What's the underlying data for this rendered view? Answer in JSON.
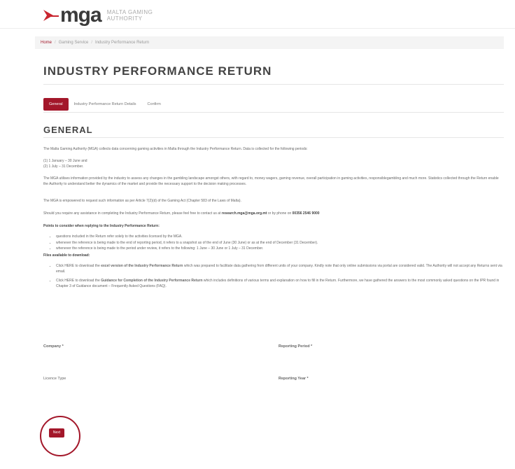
{
  "brand": {
    "logo_text": "mga",
    "logo_sub_line1": "MALTA GAMING",
    "logo_sub_line2": "AUTHORITY"
  },
  "breadcrumb": {
    "home": "Home",
    "items": [
      "Gaming Service",
      "Industry Performance Return"
    ]
  },
  "page_title": "INDUSTRY PERFORMANCE RETURN",
  "tabs": [
    {
      "label": "General",
      "active": true
    },
    {
      "label": "Industry Performance Return Details",
      "active": false
    },
    {
      "label": "Confirm",
      "active": false
    }
  ],
  "section_title": "GENERAL",
  "content": {
    "intro": "The Malta Gaming Authority (MGA) collects data concerning gaming activities in Malta through the Industry Performance Return. Data is collected for the following periods:",
    "period1": "(1) 1 January – 30 June and",
    "period2": "(2) 1 July – 31 December.",
    "utilises": "The MGA utilises information provided by the industry to assess any changes in the gambling landscape amongst others, with regard to, money wagers, gaming revenue, overall participation in gaming activities, responsiblegambling and much more. Statistics collected through the Return enable the Authority to understand better the dynamics of the market and provide the necessary support to the decision making processes.",
    "empowered": "The MGA is empowered to request such information as per Article 7(2)(d) of the Gaming Act (Chapter 583 of the Laws of Malta).",
    "assistance_pre": "Should you require any assistance in completing the Industry Performance Return, please feel free to contact us at",
    "assistance_email": "research.mga@mga.org.mt",
    "assistance_mid": "or by phone on",
    "assistance_phone": "00356 2546 9000",
    "points_heading": "Points to consider when replying to the Industry Performance Return:",
    "points": [
      "questions included in the Return refer solely to the activities licensed by the MGA.",
      "whenever the reference is being made to the end of reporting period, it refers to a snapshot as of the end of June (30 June) or as at the end of December (31 December).",
      "whenever the reference is being made to the period under review, it refers to the following: 1 June – 30 June or 1 July – 31 December."
    ],
    "files_heading": "Files available to download:",
    "file1_pre": "Click HERE to download the",
    "file1_bold": "excel version of the Industry Performance Return",
    "file1_post": "which was prepared to facilitate data gathering from different units of your company. Kindly note that only online submissions via portal are considered valid. The Authority will not accept any Returns sent via email.",
    "file2_pre": "Click HERE to download the",
    "file2_bold": "Guidance for Completion of the Industry Performance Return",
    "file2_post": "which includes definitions of various terms and explanation on how to fill in the Return. Furthermore, we have gathered the answers to the most commonly asked questions on the IPR found in Chapter 3 of Guidance document – Frequently Asked Questions (FAQ)."
  },
  "form": {
    "company_label": "Company *",
    "reporting_period_label": "Reporting Period *",
    "licence_type_label": "Licence Type",
    "reporting_year_label": "Reporting Year *"
  },
  "next_button": "Next",
  "colors": {
    "accent": "#a3172a",
    "text": "#666666",
    "heading": "#444444"
  }
}
